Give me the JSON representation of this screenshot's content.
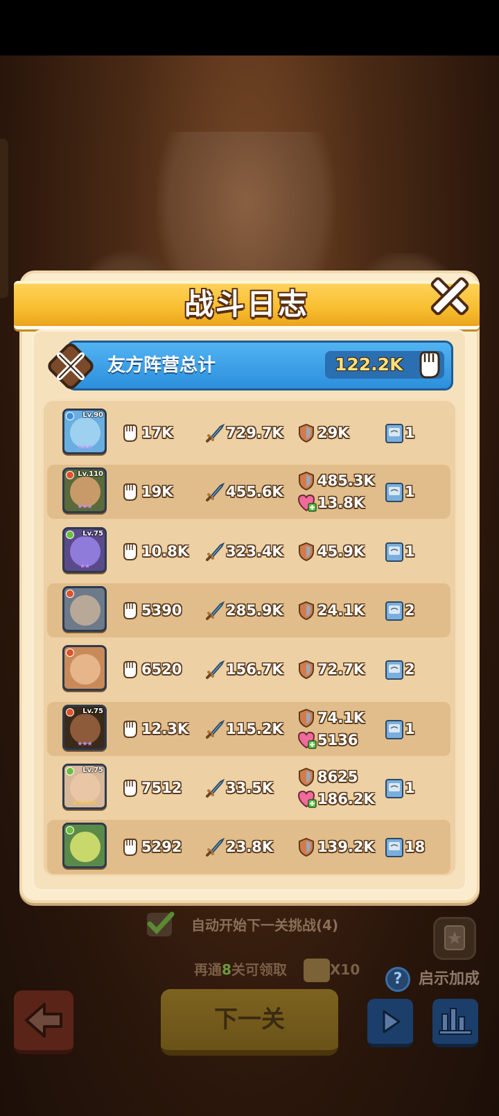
{
  "header": {
    "title": "战斗日志"
  },
  "summary": {
    "label": "友方阵营总计",
    "total": "122.2K"
  },
  "heroes": [
    {
      "level": "Lv.90",
      "element": "water",
      "stars": "★★★",
      "star_color": "#c58cf5",
      "damage": "17K",
      "attack": "729.7K",
      "defense": "29K",
      "heal": "",
      "cards": "1"
    },
    {
      "level": "Lv.110",
      "element": "fire",
      "stars": "★★★",
      "star_color": "#c58cf5",
      "damage": "19K",
      "attack": "455.6K",
      "defense": "485.3K",
      "heal": "13.8K",
      "cards": "1"
    },
    {
      "level": "Lv.75",
      "element": "nature",
      "stars": "★★",
      "star_color": "#c58cf5",
      "damage": "10.8K",
      "attack": "323.4K",
      "defense": "45.9K",
      "heal": "",
      "cards": "1"
    },
    {
      "level": "",
      "element": "fire",
      "stars": "",
      "star_color": "#c58cf5",
      "damage": "5390",
      "attack": "285.9K",
      "defense": "24.1K",
      "heal": "",
      "cards": "2"
    },
    {
      "level": "",
      "element": "fire",
      "stars": "",
      "star_color": "#c58cf5",
      "damage": "6520",
      "attack": "156.7K",
      "defense": "72.7K",
      "heal": "",
      "cards": "2"
    },
    {
      "level": "Lv.75",
      "element": "fire",
      "stars": "★★★",
      "star_color": "#c58cf5",
      "damage": "12.3K",
      "attack": "115.2K",
      "defense": "74.1K",
      "heal": "5136",
      "cards": "1"
    },
    {
      "level": "Lv.75",
      "element": "nature",
      "stars": "★★★★★",
      "star_color": "#f5c542",
      "damage": "7512",
      "attack": "33.5K",
      "defense": "8625",
      "heal": "186.2K",
      "cards": "1"
    },
    {
      "level": "",
      "element": "nature",
      "stars": "",
      "star_color": "#c58cf5",
      "damage": "5292",
      "attack": "23.8K",
      "defense": "139.2K",
      "heal": "",
      "cards": "18"
    }
  ],
  "footer": {
    "auto_label": "自动开始下一关挑战(4)",
    "reward_prefix": "再通",
    "reward_count": "8",
    "reward_suffix": "关可领取",
    "reward_multiplier": "X10",
    "hint_label": "启示加成",
    "next_label": "下一关"
  },
  "colors": {
    "panel": "#fbeccd",
    "banner": "#f8bd2f",
    "summary": "#2b8fdc",
    "row_alt": "#e1bd8b"
  },
  "icons": {
    "damage": "fist-icon",
    "attack": "sword-icon",
    "defense": "shield-icon",
    "heal": "heart-icon",
    "cards": "card-icon"
  }
}
